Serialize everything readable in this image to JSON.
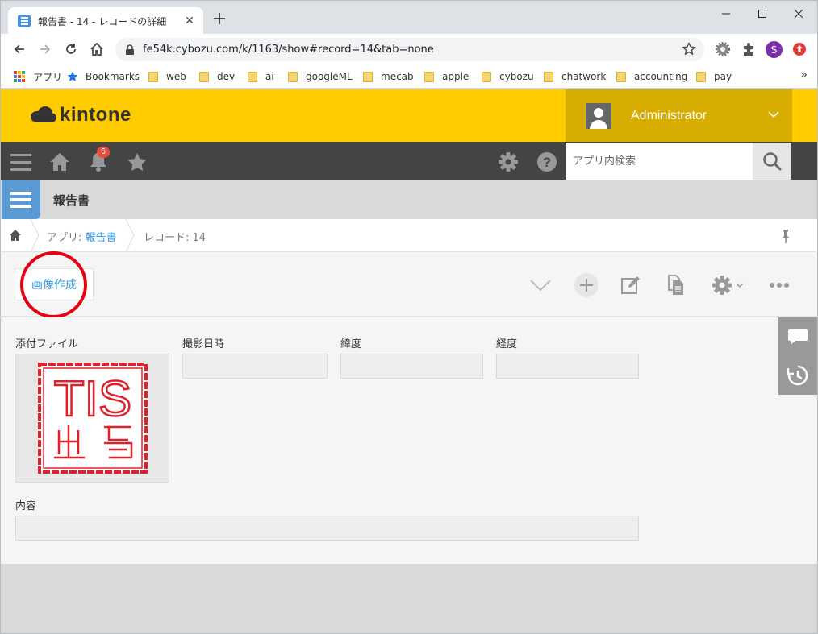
{
  "browser": {
    "tab_title": "報告書 - 14 - レコードの詳細",
    "url": "fe54k.cybozu.com/k/1163/show#record=14&tab=none",
    "profile_initial": "S",
    "bookmarks": [
      {
        "label": "アプリ",
        "icon": "apps-grid-icon"
      },
      {
        "label": "Bookmarks",
        "icon": "star-icon"
      },
      {
        "label": "web",
        "icon": "folder-icon"
      },
      {
        "label": "dev",
        "icon": "folder-icon"
      },
      {
        "label": "ai",
        "icon": "folder-icon"
      },
      {
        "label": "googleML",
        "icon": "folder-icon"
      },
      {
        "label": "mecab",
        "icon": "folder-icon"
      },
      {
        "label": "apple",
        "icon": "folder-icon"
      },
      {
        "label": "cybozu",
        "icon": "folder-icon"
      },
      {
        "label": "chatwork",
        "icon": "folder-icon"
      },
      {
        "label": "accounting",
        "icon": "folder-icon"
      },
      {
        "label": "pay",
        "icon": "folder-icon"
      }
    ],
    "bookmarks_more": "»"
  },
  "kintone": {
    "logo_text": "kintone",
    "user_name": "Administrator",
    "notification_count": "6",
    "search_placeholder": "アプリ内検索",
    "app_title": "報告書",
    "breadcrumb": {
      "app_prefix": "アプリ: ",
      "app_name": "報告書",
      "record_label": "レコード: 14"
    },
    "custom_button_label": "画像作成",
    "fields": {
      "attachment_label": "添付ファイル",
      "datetime_label": "撮影日時",
      "latitude_label": "緯度",
      "longitude_label": "経度",
      "content_label": "内容",
      "datetime_value": "",
      "latitude_value": "",
      "longitude_value": "",
      "content_value": ""
    },
    "stamp_letters": "TIS",
    "colors": {
      "header_yellow": "#ffcc00",
      "user_area": "#d6ad00",
      "nav_dark": "#444444",
      "app_icon_blue": "#5b9bd5",
      "link_blue": "#3498db",
      "annotation_red": "#e50012",
      "stamp_red": "#e0202a"
    }
  }
}
